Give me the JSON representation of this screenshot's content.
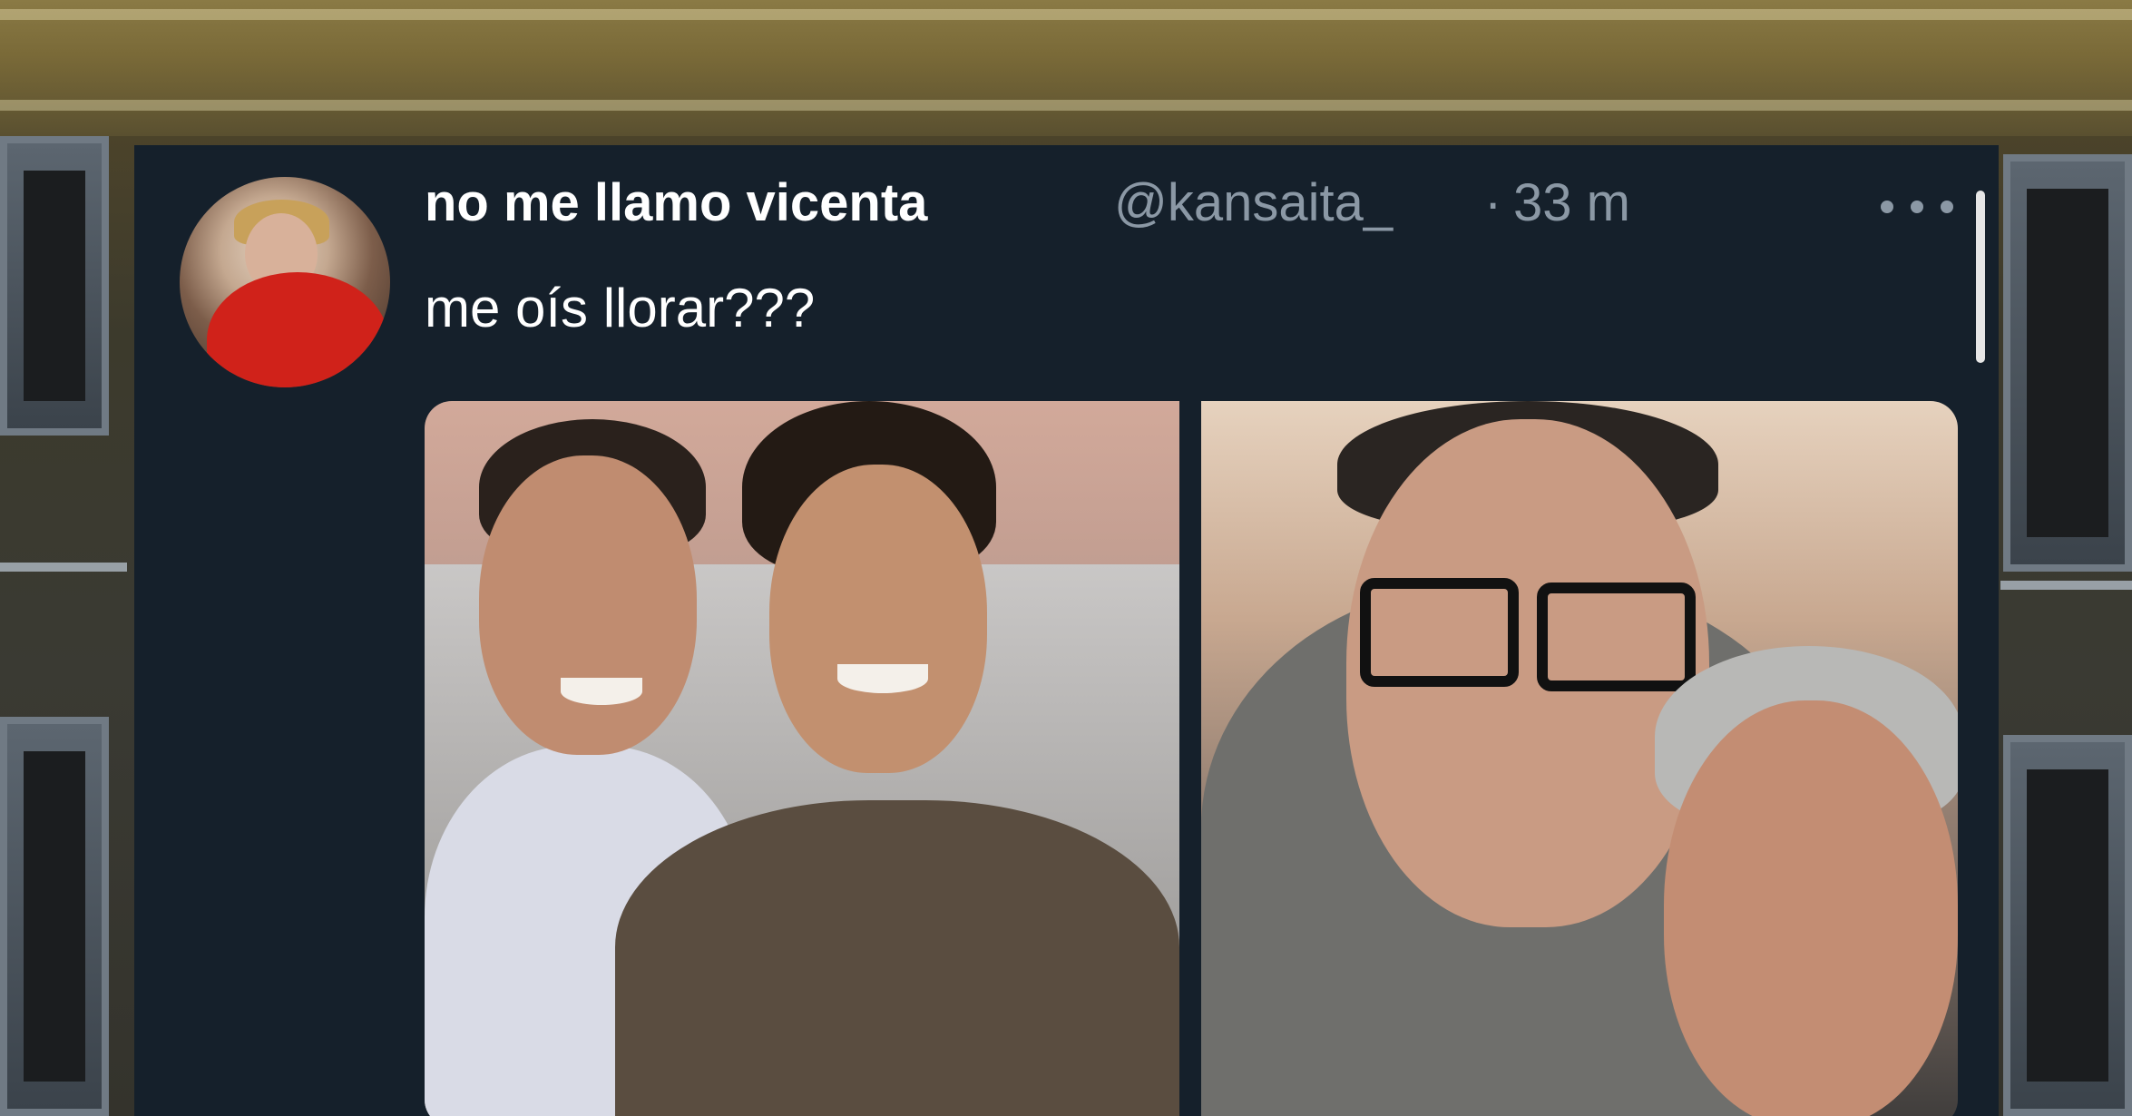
{
  "tweet": {
    "display_name": "no me llamo vicenta",
    "handle": "@kansaita_",
    "separator": "·",
    "time": "33 m",
    "text": "me oís llorar???",
    "more_icon": "more-horizontal-icon"
  },
  "colors": {
    "card_background": "#15202b",
    "name_text": "#ffffff",
    "secondary_text": "#8b98a5"
  }
}
